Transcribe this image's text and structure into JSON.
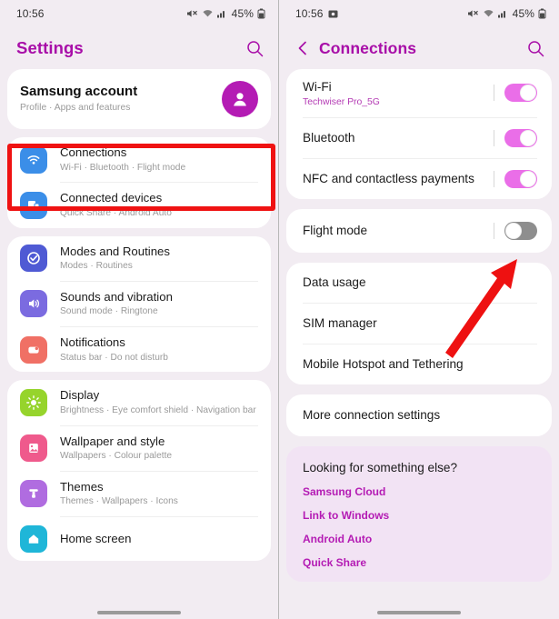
{
  "left": {
    "status": {
      "time": "10:56",
      "battery": "45%",
      "icons": [
        "mute-icon",
        "wifi-icon",
        "signal-icon",
        "battery-icon"
      ]
    },
    "header": {
      "title": "Settings",
      "search_icon": "search-icon"
    },
    "account": {
      "title": "Samsung account",
      "subtitle": "Profile  ·  Apps and features",
      "avatar_icon": "person-icon"
    },
    "groups": [
      {
        "items": [
          {
            "title": "Connections",
            "subtitle": "Wi-Fi  ·  Bluetooth  ·  Flight mode",
            "icon": "wifi-icon",
            "icon_color": "#3b8ee8",
            "highlighted": true
          },
          {
            "title": "Connected devices",
            "subtitle": "Quick Share  ·  Android Auto",
            "icon": "devices-icon",
            "icon_color": "#3b8ee8",
            "highlighted": false
          }
        ]
      },
      {
        "items": [
          {
            "title": "Modes and Routines",
            "subtitle": "Modes  ·  Routines",
            "icon": "modes-icon",
            "icon_color": "#4f5ad4",
            "highlighted": false
          },
          {
            "title": "Sounds and vibration",
            "subtitle": "Sound mode  ·  Ringtone",
            "icon": "speaker-icon",
            "icon_color": "#7b6be0",
            "highlighted": false
          },
          {
            "title": "Notifications",
            "subtitle": "Status bar  ·  Do not disturb",
            "icon": "notification-icon",
            "icon_color": "#f07065",
            "highlighted": false
          }
        ]
      },
      {
        "items": [
          {
            "title": "Display",
            "subtitle": "Brightness  ·  Eye comfort shield  ·  Navigation bar",
            "icon": "brightness-icon",
            "icon_color": "#96d42c",
            "highlighted": false
          },
          {
            "title": "Wallpaper and style",
            "subtitle": "Wallpapers  ·  Colour palette",
            "icon": "image-icon",
            "icon_color": "#ef5a8c",
            "highlighted": false
          },
          {
            "title": "Themes",
            "subtitle": "Themes  ·  Wallpapers  ·  Icons",
            "icon": "brush-icon",
            "icon_color": "#b06ce0",
            "highlighted": false
          },
          {
            "title": "Home screen",
            "subtitle": "",
            "icon": "home-icon",
            "icon_color": "#1fb6d8",
            "highlighted": false
          }
        ]
      }
    ]
  },
  "right": {
    "status": {
      "time": "10:56",
      "battery": "45%",
      "icons": [
        "screenshot-icon",
        "mute-icon",
        "wifi-icon",
        "signal-icon",
        "battery-icon"
      ]
    },
    "header": {
      "title": "Connections",
      "back_icon": "chevron-left-icon",
      "search_icon": "search-icon"
    },
    "toggle_group": [
      {
        "title": "Wi-Fi",
        "subtitle": "Techwiser Pro_5G",
        "toggle": "on"
      },
      {
        "title": "Bluetooth",
        "subtitle": "",
        "toggle": "on"
      },
      {
        "title": "NFC and contactless payments",
        "subtitle": "",
        "toggle": "on"
      }
    ],
    "flight_group": [
      {
        "title": "Flight mode",
        "subtitle": "",
        "toggle": "off"
      }
    ],
    "plain_group": [
      {
        "title": "Data usage"
      },
      {
        "title": "SIM manager"
      },
      {
        "title": "Mobile Hotspot and Tethering"
      }
    ],
    "more_group": [
      {
        "title": "More connection settings"
      }
    ],
    "looking_for": {
      "title": "Looking for something else?",
      "links": [
        "Samsung Cloud",
        "Link to Windows",
        "Android Auto",
        "Quick Share"
      ]
    }
  },
  "annotations": {
    "highlight_color": "#ef1212",
    "arrow_color": "#ee1111",
    "arrow_target": "flight-mode-toggle"
  }
}
